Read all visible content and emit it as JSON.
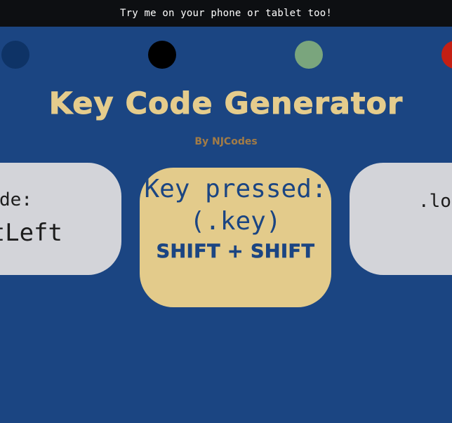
{
  "banner": {
    "text": "Try me on your phone or tablet too!"
  },
  "theme_dots": [
    {
      "name": "navy-theme-dot",
      "color": "#0e3366"
    },
    {
      "name": "black-theme-dot",
      "color": "#000000"
    },
    {
      "name": "green-theme-dot",
      "color": "#7aa57d"
    },
    {
      "name": "red-theme-dot",
      "color": "#c41f14"
    }
  ],
  "header": {
    "title": "Key Code Generator",
    "subtitle": "By NJCodes"
  },
  "cards": {
    "left": {
      "label": "ode:",
      "value": "tLeft"
    },
    "center": {
      "label_line1": "Key pressed:",
      "label_line2": "(.key)",
      "value": "SHIFT + SHIFT"
    },
    "right": {
      "label": ".loc"
    }
  },
  "colors": {
    "background": "#1b4582",
    "banner": "#0d0f12",
    "title": "#e5cc8c",
    "subtitle": "#a37c46",
    "card_gray": "#d3d4d9",
    "card_gold": "#e3cb8b"
  }
}
